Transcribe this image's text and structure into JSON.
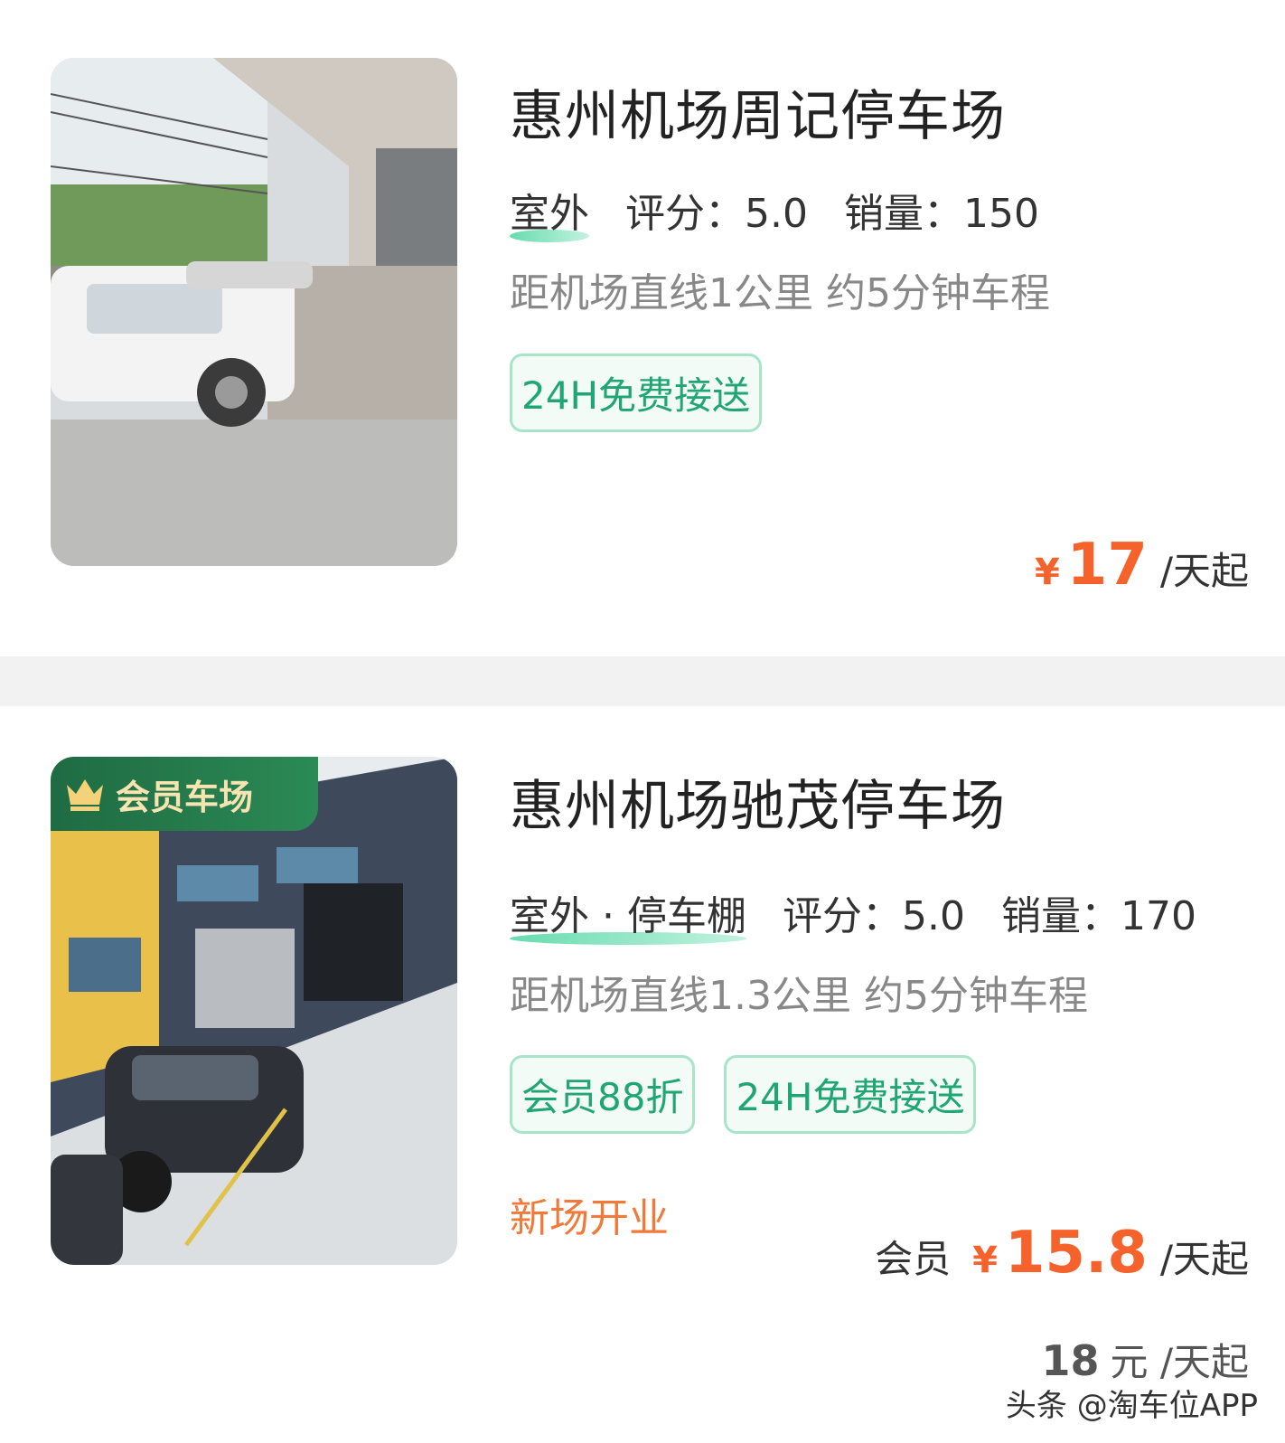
{
  "listings": [
    {
      "name": "惠州机场周记停车场",
      "type": "室外",
      "rating": "评分：5.0",
      "sales": "销量：150",
      "distance": "距机场直线1公里 约5分钟车程",
      "tags": [
        "24H免费接送"
      ],
      "price": {
        "currency": "¥",
        "value": "17",
        "unit": "/天起"
      }
    },
    {
      "badge": "会员车场",
      "name": "惠州机场驰茂停车场",
      "type": "室外 · 停车棚",
      "rating": "评分：5.0",
      "sales": "销量：170",
      "distance": "距机场直线1.3公里 约5分钟车程",
      "tags": [
        "会员88折",
        "24H免费接送"
      ],
      "promo": "新场开业",
      "price": {
        "member_label": "会员",
        "currency": "¥",
        "value": "15.8",
        "unit": "/天起"
      },
      "original_price": {
        "value": "18",
        "unit": "元 /天起"
      }
    }
  ],
  "watermark": "头条 @淘车位APP",
  "colors": {
    "accent_green": "#1fa673",
    "price_orange": "#f5622b",
    "promo_orange": "#f07a3a",
    "badge_green": "#1f6b43"
  }
}
